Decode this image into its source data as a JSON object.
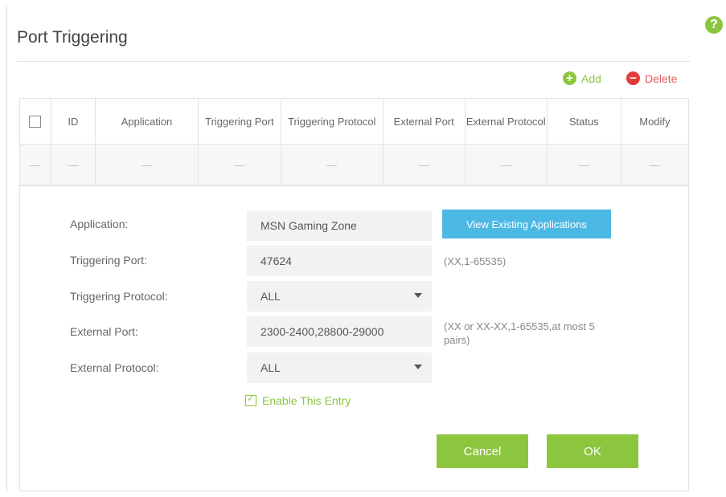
{
  "page": {
    "title": "Port Triggering"
  },
  "help": {
    "symbol": "?"
  },
  "toolbar": {
    "add_label": "Add",
    "delete_label": "Delete"
  },
  "table": {
    "columns": [
      "ID",
      "Application",
      "Triggering Port",
      "Triggering Protocol",
      "External Port",
      "External Protocol",
      "Status",
      "Modify"
    ],
    "empty_row": [
      "—",
      "—",
      "—",
      "—",
      "—",
      "—",
      "—",
      "—",
      "—"
    ]
  },
  "form": {
    "application_label": "Application:",
    "application_value": "MSN Gaming Zone",
    "view_apps_button": "View Existing Applications",
    "triggering_port_label": "Triggering Port:",
    "triggering_port_value": "47624",
    "triggering_port_hint": "(XX,1-65535)",
    "triggering_protocol_label": "Triggering Protocol:",
    "triggering_protocol_value": "ALL",
    "external_port_label": "External Port:",
    "external_port_value": "2300-2400,28800-29000",
    "external_port_hint": "(XX or XX-XX,1-65535,at most 5 pairs)",
    "external_protocol_label": "External Protocol:",
    "external_protocol_value": "ALL",
    "enable_label": "Enable This Entry",
    "enable_checked": true,
    "cancel_label": "Cancel",
    "ok_label": "OK"
  },
  "colors": {
    "accent_green": "#8cc63f",
    "button_blue": "#4cb8e4",
    "delete_red": "#e43a3a"
  }
}
